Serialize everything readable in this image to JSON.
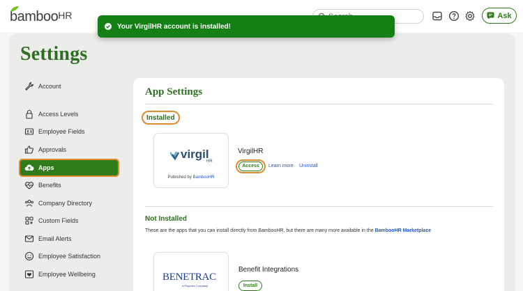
{
  "brand": {
    "logo_text_main": "bamboo",
    "logo_text_hr": "HR"
  },
  "header": {
    "search": {
      "placeholder": "Search"
    },
    "icons": [
      "inbox-icon",
      "help-icon",
      "gear-icon"
    ],
    "ask_label": "Ask"
  },
  "toast": {
    "message": "Your VirgilHR account is installed!"
  },
  "page": {
    "title": "Settings"
  },
  "sidebar": {
    "items": [
      {
        "label": "Account",
        "icon": "wrench-icon",
        "active": false
      },
      {
        "label": "Access Levels",
        "icon": "lock-icon",
        "active": false
      },
      {
        "label": "Employee Fields",
        "icon": "id-card-icon",
        "active": false
      },
      {
        "label": "Approvals",
        "icon": "thumbs-up-icon",
        "active": false
      },
      {
        "label": "Apps",
        "icon": "cloud-upload-icon",
        "active": true
      },
      {
        "label": "Benefits",
        "icon": "heart-pulse-icon",
        "active": false
      },
      {
        "label": "Company Directory",
        "icon": "people-icon",
        "active": false
      },
      {
        "label": "Custom Fields",
        "icon": "grid-plus-icon",
        "active": false
      },
      {
        "label": "Email Alerts",
        "icon": "mail-icon",
        "active": false
      },
      {
        "label": "Employee Satisfaction",
        "icon": "smile-icon",
        "active": false
      },
      {
        "label": "Employee Wellbeing",
        "icon": "wellbeing-icon",
        "active": false
      }
    ]
  },
  "main": {
    "title": "App Settings",
    "installed": {
      "heading": "Installed",
      "apps": [
        {
          "name": "VirgilHR",
          "logo_text": "virgil",
          "logo_sub": "HR",
          "published_prefix": "Published by",
          "publisher": "BambooHR",
          "access_label": "Access",
          "learn_more_label": "Learn more",
          "uninstall_label": "Uninstall"
        }
      ]
    },
    "not_installed": {
      "heading": "Not Installed",
      "description": "These are the apps that you can install directly from BambooHR, but there are many more available in the",
      "marketplace_link": "BambooHR Marketplace",
      "apps": [
        {
          "name": "Benefit Integrations",
          "logo_text": "BENETRAC",
          "logo_sub": "A Paychex Company",
          "install_label": "Install"
        }
      ]
    }
  },
  "colors": {
    "brand_green": "#2e7d1a",
    "title_green": "#2f6f22",
    "toast_green": "#147f14",
    "highlight_orange": "#e08a2e",
    "link_blue": "#2456c9"
  }
}
